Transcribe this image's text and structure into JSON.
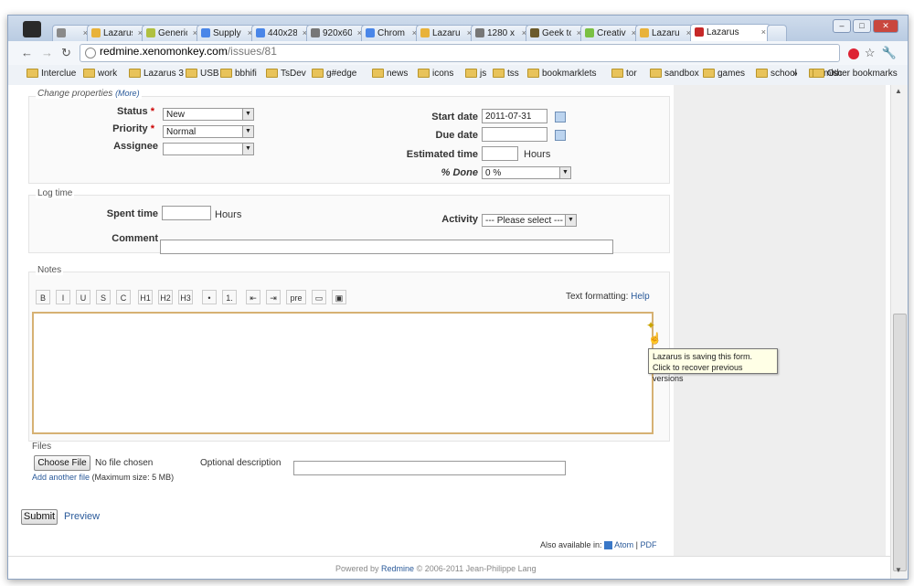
{
  "browser": {
    "tabs": [
      {
        "label": "",
        "icon": "wrench-icon"
      },
      {
        "label": "Lazarus",
        "icon": "lazarus-icon"
      },
      {
        "label": "Generic",
        "icon": "generic-icon"
      },
      {
        "label": "Supply",
        "icon": "google-icon"
      },
      {
        "label": "440x28",
        "icon": "google-icon"
      },
      {
        "label": "920x60",
        "icon": "globe-icon"
      },
      {
        "label": "Chrom",
        "icon": "google-icon"
      },
      {
        "label": "Lazaru",
        "icon": "lazarus-icon"
      },
      {
        "label": "1280 x",
        "icon": "globe-icon"
      },
      {
        "label": "Geek to",
        "icon": "book-icon"
      },
      {
        "label": "Creativ",
        "icon": "ct-icon"
      },
      {
        "label": "Lazaru",
        "icon": "lazarus-icon"
      },
      {
        "label": "Lazarus",
        "icon": "redmine-icon",
        "active": true
      }
    ],
    "url_host": "redmine.xenomonkey.com",
    "url_path": "/issues/81",
    "bookmarks": [
      "Interclue",
      "work",
      "Lazarus 3",
      "USB",
      "bbhifi",
      "TsDev",
      "g#edge",
      "news",
      "icons",
      "js",
      "tss",
      "bookmarklets",
      "tor",
      "sandbox",
      "games",
      "school",
      "misc"
    ],
    "bookmarks_more": "»",
    "other_bookmarks": "Other bookmarks",
    "accent_color": "#2a5a9a"
  },
  "form": {
    "change_properties": "Change properties",
    "more": "(More)",
    "status_label": "Status",
    "status_value": "New",
    "priority_label": "Priority",
    "priority_value": "Normal",
    "assignee_label": "Assignee",
    "assignee_value": "",
    "required_mark": "*",
    "start_date_label": "Start date",
    "start_date_value": "2011-07-31",
    "due_date_label": "Due date",
    "due_date_value": "",
    "estimated_time_label": "Estimated time",
    "hours_unit": "Hours",
    "done_label": "% Done",
    "done_value": "0 %",
    "log_time": "Log time",
    "spent_time_label": "Spent time",
    "activity_label": "Activity",
    "activity_value": "--- Please select ---",
    "comment_label": "Comment",
    "notes_legend": "Notes",
    "toolbar_buttons": [
      "B",
      "I",
      "U",
      "S",
      "C",
      "H1",
      "H2",
      "H3",
      "•",
      "1.",
      "⇤",
      "⇥",
      "pre",
      "▭",
      "▣"
    ],
    "text_formatting": "Text formatting:",
    "help": "Help",
    "tooltip_line1": "Lazarus is saving this form.",
    "tooltip_line2": "Click to recover previous versions",
    "files_label": "Files",
    "choose_file": "Choose File",
    "no_file": "No file chosen",
    "optional_description": "Optional description",
    "add_another_file": "Add another file",
    "max_size": "(Maximum size: 5 MB)"
  },
  "actions": {
    "submit": "Submit",
    "preview": "Preview"
  },
  "footer": {
    "also_available": "Also available in:",
    "atom": "Atom",
    "separator": "|",
    "pdf": "PDF",
    "powered_by": "Powered by",
    "redmine": "Redmine",
    "copyright": "© 2006-2011 Jean-Philippe Lang"
  }
}
